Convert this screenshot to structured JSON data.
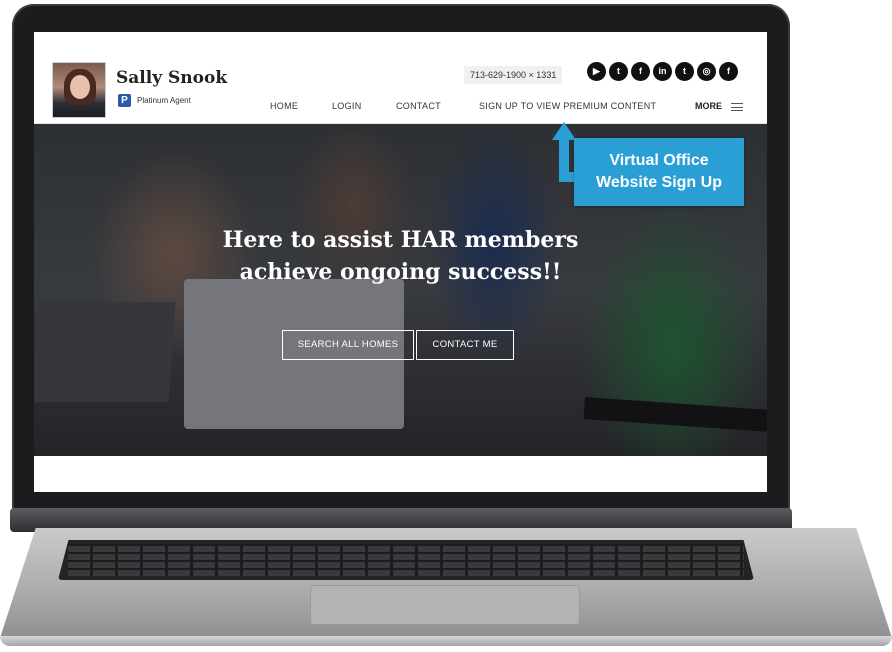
{
  "agent": {
    "name": "Sally Snook",
    "badge_letter": "P",
    "level": "Platinum Agent"
  },
  "header": {
    "phone": "713-629-1900 × 1331",
    "socials": [
      {
        "icon": "youtube-icon",
        "glyph": "▶"
      },
      {
        "icon": "twitter-icon",
        "glyph": "t"
      },
      {
        "icon": "facebook-icon",
        "glyph": "f"
      },
      {
        "icon": "linkedin-icon",
        "glyph": "in"
      },
      {
        "icon": "twitter-icon",
        "glyph": "t"
      },
      {
        "icon": "instagram-icon",
        "glyph": "◎"
      },
      {
        "icon": "facebook-icon",
        "glyph": "f"
      }
    ]
  },
  "nav": {
    "items": [
      "HOME",
      "LOGIN",
      "CONTACT",
      "SIGN UP TO VIEW PREMIUM CONTENT"
    ],
    "more": "MORE"
  },
  "hero": {
    "title_line1": "Here to assist HAR members",
    "title_line2": "achieve ongoing success!!",
    "search_button": "SEARCH ALL HOMES",
    "contact_button": "CONTACT ME"
  },
  "callout": {
    "line1": "Virtual Office",
    "line2": "Website Sign Up",
    "color": "#2a9fd6"
  }
}
